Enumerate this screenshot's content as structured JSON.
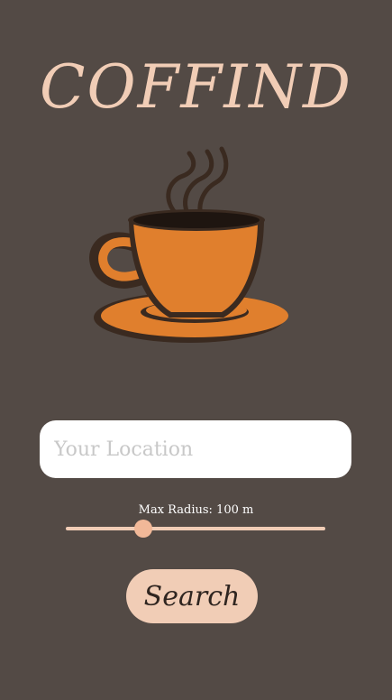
{
  "app": {
    "title": "COFFIND",
    "logo_icon": "coffee-cup-icon"
  },
  "search": {
    "location_placeholder": "Your Location",
    "location_value": "",
    "radius_label": "Max Radius: 100 m",
    "radius_fraction": 0.3,
    "button_label": "Search"
  },
  "colors": {
    "background": "#534a45",
    "accent": "#f1cdb6",
    "cup_orange": "#e07f2d",
    "cup_dark": "#3a2a20"
  }
}
